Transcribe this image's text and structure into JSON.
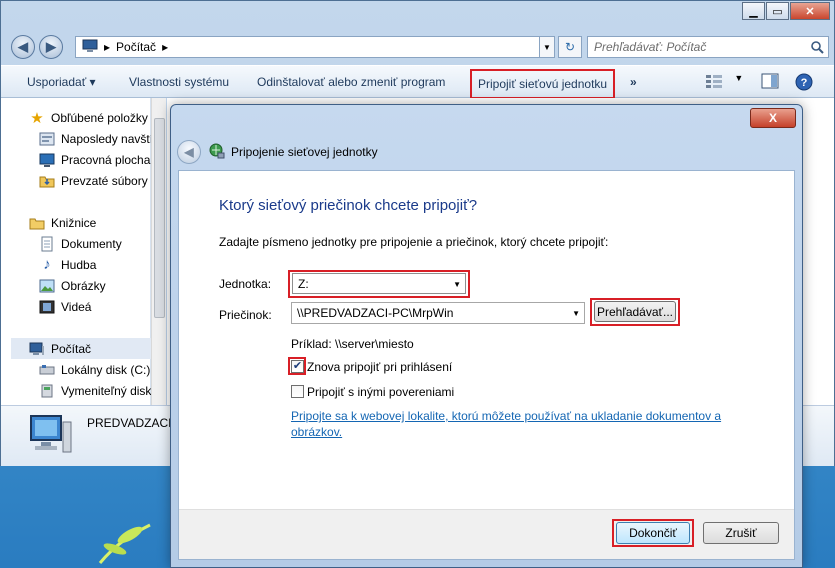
{
  "explorer": {
    "address": {
      "breadcrumb": "Počítač"
    },
    "search": {
      "placeholder": "Prehľadávať: Počítač"
    },
    "toolbar": {
      "organize": "Usporiadať",
      "system_properties": "Vlastnosti systému",
      "uninstall": "Odinštalovať alebo zmeniť program",
      "map_drive": "Pripojiť sieťovú jednotku",
      "more": "»"
    },
    "sidebar": {
      "items": [
        {
          "label": "Obľúbené položky",
          "icon": "star-icon"
        },
        {
          "label": "Naposledy navští",
          "icon": "recent-places-icon"
        },
        {
          "label": "Pracovná plocha",
          "icon": "desktop-icon"
        },
        {
          "label": "Prevzaté súbory",
          "icon": "downloads-icon"
        },
        {
          "label": "Knižnice",
          "icon": "libraries-icon"
        },
        {
          "label": "Dokumenty",
          "icon": "documents-icon"
        },
        {
          "label": "Hudba",
          "icon": "music-icon"
        },
        {
          "label": "Obrázky",
          "icon": "pictures-icon"
        },
        {
          "label": "Videá",
          "icon": "videos-icon"
        },
        {
          "label": "Počítač",
          "icon": "computer-icon"
        },
        {
          "label": "Lokálny disk (C:)",
          "icon": "local-disk-icon"
        },
        {
          "label": "Vymeniteľný disk",
          "icon": "removable-disk-icon"
        }
      ]
    },
    "details": {
      "computer_name": "PREDVADZACI-"
    }
  },
  "dialog": {
    "window_title": "Pripojenie sieťovej jednotky",
    "heading": "Ktorý sieťový priečinok chcete pripojiť?",
    "instruction": "Zadajte písmeno jednotky pre pripojenie a priečinok, ktorý chcete pripojiť:",
    "drive_label": "Jednotka:",
    "drive_value": "Z:",
    "folder_label": "Priečinok:",
    "folder_value": "\\\\PREDVADZACI-PC\\MrpWin",
    "browse_label": "Prehľadávať...",
    "example": "Príklad: \\\\server\\miesto",
    "reconnect_label": "Znova pripojiť pri prihlásení",
    "reconnect_checked": true,
    "other_creds_label": "Pripojiť s inými povereniami",
    "other_creds_checked": false,
    "link_text": "Pripojte sa k webovej lokalite, ktorú môžete používať na ukladanie dokumentov a obrázkov.",
    "finish_label": "Dokončiť",
    "cancel_label": "Zrušiť",
    "close_glyph": "X"
  },
  "colors": {
    "highlight": "#d81f26",
    "link": "#1466b3",
    "heading": "#1a3a8a"
  }
}
